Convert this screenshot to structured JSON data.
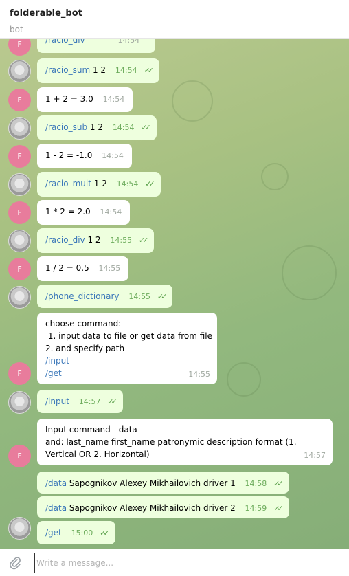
{
  "header": {
    "title": "folderable_bot",
    "subtitle": "bot"
  },
  "composer": {
    "placeholder": "Write a message..."
  },
  "avatars": {
    "bot_letter": "F"
  },
  "messages": [
    {
      "cmd": "/racio_div",
      "time": "14:54"
    },
    {
      "cmd": "/racio_sum",
      "args": " 1 2",
      "time": "14:54",
      "read": "✓✓"
    },
    {
      "text": "1 + 2 = 3.0",
      "time": "14:54"
    },
    {
      "cmd": "/racio_sub",
      "args": " 1 2",
      "time": "14:54",
      "read": "✓✓"
    },
    {
      "text": "1 - 2 = -1.0",
      "time": "14:54"
    },
    {
      "cmd": "/racio_mult",
      "args": " 1 2",
      "time": "14:54",
      "read": "✓✓"
    },
    {
      "text": "1 * 2 = 2.0",
      "time": "14:54"
    },
    {
      "cmd": "/racio_div",
      "args": " 1 2",
      "time": "14:55",
      "read": "✓✓"
    },
    {
      "text": "1 / 2 = 0.5",
      "time": "14:55"
    },
    {
      "cmd": "/phone_dictionary",
      "time": "14:55",
      "read": "✓✓"
    },
    {
      "line1": "choose command:",
      "line2": " 1. input data to file or get data from file",
      "line3": "2. and specify path",
      "cmd1": "/input",
      "cmd2": "/get",
      "time": "14:55"
    },
    {
      "cmd": "/input",
      "time": "14:57",
      "read": "✓✓"
    },
    {
      "line1": "Input command - data",
      "line2": "and: last_name first_name patronymic description format (1.",
      "line3": "Vertical OR 2. Horizontal)",
      "time": "14:57"
    },
    {
      "cmd": "/data",
      "args": " Sapognikov Alexey Mikhailovich driver 1",
      "time": "14:58",
      "read": "✓✓"
    },
    {
      "cmd": "/data",
      "args": " Sapognikov Alexey Mikhailovich driver 2",
      "time": "14:59",
      "read": "✓✓"
    },
    {
      "cmd": "/get",
      "time": "15:00",
      "read": "✓✓"
    }
  ]
}
